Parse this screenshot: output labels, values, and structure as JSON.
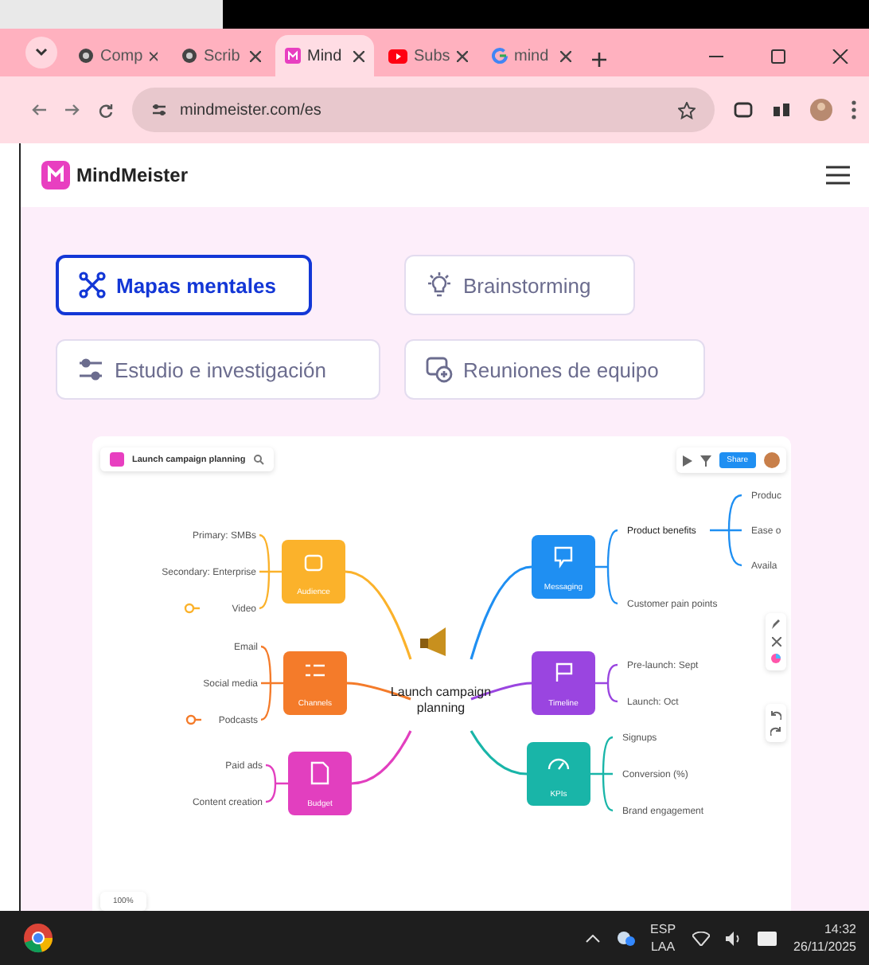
{
  "browser": {
    "tabs": [
      {
        "title": "Comp",
        "selected": false
      },
      {
        "title": "Scrib",
        "selected": false
      },
      {
        "title": "Mind",
        "selected": true
      },
      {
        "title": "Subs",
        "selected": false
      },
      {
        "title": "mind",
        "selected": false
      }
    ],
    "url": "mindmeister.com/es"
  },
  "header": {
    "logo": "MindMeister"
  },
  "categories": [
    {
      "label": "Mapas mentales",
      "selected": true
    },
    {
      "label": "Brainstorming",
      "selected": false
    },
    {
      "label": "Estudio e investigación",
      "selected": false
    },
    {
      "label": "Reuniones de equipo",
      "selected": false
    }
  ],
  "map": {
    "title": "Launch campaign planning",
    "share": "Share",
    "zoom": "100%",
    "center": [
      "Launch campaign",
      "planning"
    ],
    "branches": [
      {
        "label": "Audience",
        "color": "#fbb22b",
        "leaves": [
          {
            "label": "Primary: SMBs",
            "marker": false
          },
          {
            "label": "Secondary: Enterprise",
            "marker": false
          },
          {
            "label": "Video",
            "marker": true
          }
        ]
      },
      {
        "label": "Channels",
        "color": "#f47b2a",
        "leaves": [
          {
            "label": "Email",
            "marker": false
          },
          {
            "label": "Social media",
            "marker": false
          },
          {
            "label": "Podcasts",
            "marker": true
          }
        ]
      },
      {
        "label": "Budget",
        "color": "#e23fbf",
        "leaves": [
          {
            "label": "Paid ads",
            "marker": false
          },
          {
            "label": "Content creation",
            "marker": false
          }
        ]
      },
      {
        "label": "Messaging",
        "color": "#1f8ff2",
        "leaves": [
          {
            "label": "Product benefits",
            "marker": false,
            "children": [
              "Produc",
              "Ease o",
              "Availa"
            ]
          },
          {
            "label": "Customer pain points",
            "marker": false
          }
        ]
      },
      {
        "label": "Timeline",
        "color": "#9a45e0",
        "leaves": [
          {
            "label": "Pre-launch: Sept",
            "marker": false
          },
          {
            "label": "Launch: Oct",
            "marker": false
          }
        ]
      },
      {
        "label": "KPIs",
        "color": "#19b5a8",
        "leaves": [
          {
            "label": "Signups",
            "marker": false
          },
          {
            "label": "Conversion (%)",
            "marker": false
          },
          {
            "label": "Brand engagement",
            "marker": false
          }
        ]
      }
    ]
  },
  "taskbar": {
    "language": [
      "ESP",
      "LAA"
    ],
    "time": "14:32",
    "date": "26/11/2025"
  }
}
